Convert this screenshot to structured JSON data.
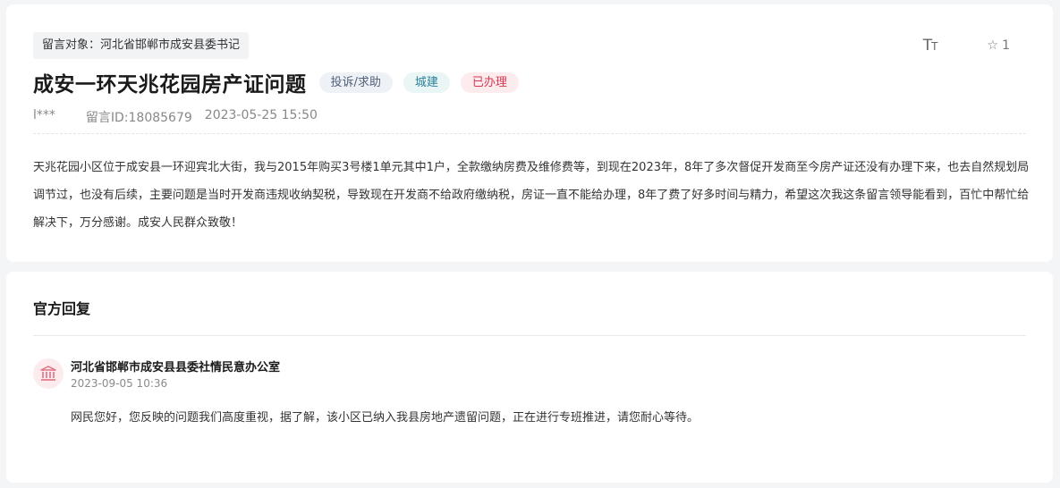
{
  "message": {
    "target_label": "留言对象：河北省邯郸市成安县委书记",
    "title": "成安一环天兆花园房产证问题",
    "tags": {
      "type": "投诉/求助",
      "category": "城建",
      "status": "已办理"
    },
    "author": "l***",
    "message_id": "留言ID:18085679",
    "datetime": "2023-05-25 15:50",
    "body": "天兆花园小区位于成安县一环迎宾北大街，我与2015年购买3号楼1单元其中1户，全款缴纳房费及维修费等，到现在2023年，8年了多次督促开发商至今房产证还没有办理下来，也去自然规划局调节过，也没有后续，主要问题是当时开发商违规收纳契税，导致现在开发商不给政府缴纳税，房证一直不能给办理，8年了费了好多时间与精力，希望这次我这条留言领导能看到，百忙中帮忙给解决下，万分感谢。成安人民群众致敬！"
  },
  "toolbar": {
    "font_size_icon": "font-size-icon",
    "star_icon": "star-outline-icon",
    "star_count": "1"
  },
  "reply": {
    "heading": "官方回复",
    "org_icon": "government-building-icon",
    "org_name": "河北省邯郸市成安县县委社情民意办公室",
    "datetime": "2023-09-05 10:36",
    "text": "网民您好，您反映的问题我们高度重视，据了解，该小区已纳入我县房地产遗留问题，正在进行专班推进，请您耐心等待。"
  },
  "colors": {
    "status_red": "#d83a52",
    "category_teal": "#2b7f9a",
    "type_slate": "#52617a",
    "page_bg": "#f4f5f7"
  }
}
